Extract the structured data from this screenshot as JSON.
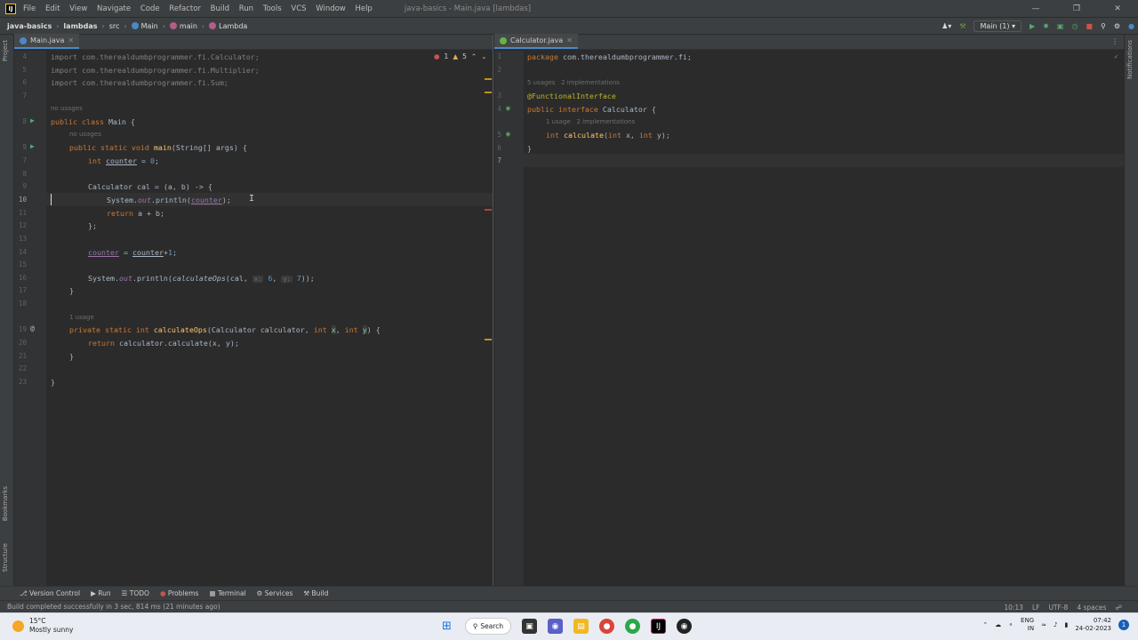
{
  "titlebar": {
    "menu": [
      "File",
      "Edit",
      "View",
      "Navigate",
      "Code",
      "Refactor",
      "Build",
      "Run",
      "Tools",
      "VCS",
      "Window",
      "Help"
    ],
    "window_title": "java-basics - Main.java [lambdas]"
  },
  "breadcrumb": [
    "java-basics",
    "lambdas",
    "src",
    "Main",
    "main",
    "Lambda"
  ],
  "run_config": "Main (1)",
  "left_tool_labels": [
    "Project",
    "Bookmarks",
    "Structure"
  ],
  "right_tool_labels": [
    "Notifications"
  ],
  "left_editor": {
    "tab": "Main.java",
    "inspections": {
      "errors": "1",
      "warnings": "5"
    }
  },
  "right_editor": {
    "tab": "Calculator.java"
  },
  "main_lines": [
    {
      "n": "4",
      "text": "import com.therealdumbprogrammer.fi.Calculator;"
    },
    {
      "n": "5",
      "text": "import com.therealdumbprogrammer.fi.Multiplier;"
    },
    {
      "n": "6",
      "text": "import com.therealdumbprogrammer.fi.Sum;"
    },
    {
      "n": "7",
      "text": ""
    },
    {
      "n": "8",
      "text": "public class Main {"
    },
    {
      "n": "9",
      "text": "public static void main(String[] args) {"
    },
    {
      "n": "7",
      "text": "int counter = 0;"
    },
    {
      "n": "8",
      "text": ""
    },
    {
      "n": "9",
      "text": "Calculator cal = (a, b) -> {"
    },
    {
      "n": "10",
      "text": "System.out.println(counter);"
    },
    {
      "n": "11",
      "text": "return a + b;"
    },
    {
      "n": "12",
      "text": "};"
    },
    {
      "n": "13",
      "text": ""
    },
    {
      "n": "14",
      "text": "counter = counter+1;"
    },
    {
      "n": "15",
      "text": ""
    },
    {
      "n": "16",
      "text": "System.out.println(calculateOps(cal, x: 6, y: 7));"
    },
    {
      "n": "17",
      "text": "}"
    },
    {
      "n": "18",
      "text": ""
    },
    {
      "n": "19",
      "text": "private static int calculateOps(Calculator calculator, int x, int y) {"
    },
    {
      "n": "20",
      "text": "return calculator.calculate(x, y);"
    },
    {
      "n": "21",
      "text": "}"
    },
    {
      "n": "22",
      "text": ""
    },
    {
      "n": "23",
      "text": "}"
    }
  ],
  "main_hints": {
    "class_usage": "no usages",
    "main_usage": "no usages",
    "calc_usage": "1 usage"
  },
  "calc_lines": [
    {
      "n": "1",
      "text": "package com.therealdumbprogrammer.fi;"
    },
    {
      "n": "2",
      "text": ""
    },
    {
      "n": "3",
      "text": "@FunctionalInterface"
    },
    {
      "n": "4",
      "text": "public interface Calculator {"
    },
    {
      "n": "5",
      "text": "int calculate(int x, int y);"
    },
    {
      "n": "6",
      "text": "}"
    },
    {
      "n": "7",
      "text": ""
    }
  ],
  "calc_hints": {
    "iface": "5 usages   2 implementations",
    "method": "1 usage   2 implementations"
  },
  "bottom_tools": [
    "Version Control",
    "Run",
    "TODO",
    "Problems",
    "Terminal",
    "Services",
    "Build"
  ],
  "status": {
    "message": "Build completed successfully in 3 sec, 814 ms (21 minutes ago)",
    "position": "10:13",
    "line_sep": "LF",
    "encoding": "UTF-8",
    "indent": "4 spaces"
  },
  "taskbar": {
    "temp": "15°C",
    "weather": "Mostly sunny",
    "search": "Search",
    "lang1": "ENG",
    "lang2": "IN",
    "time": "07:42",
    "date": "24-02-2023",
    "notif": "1"
  },
  "colors": {
    "keyword": "#cc7832",
    "function": "#ffc66d",
    "number": "#6897bb",
    "annotation": "#bbb529",
    "tab_accent": "#4a88c7"
  }
}
